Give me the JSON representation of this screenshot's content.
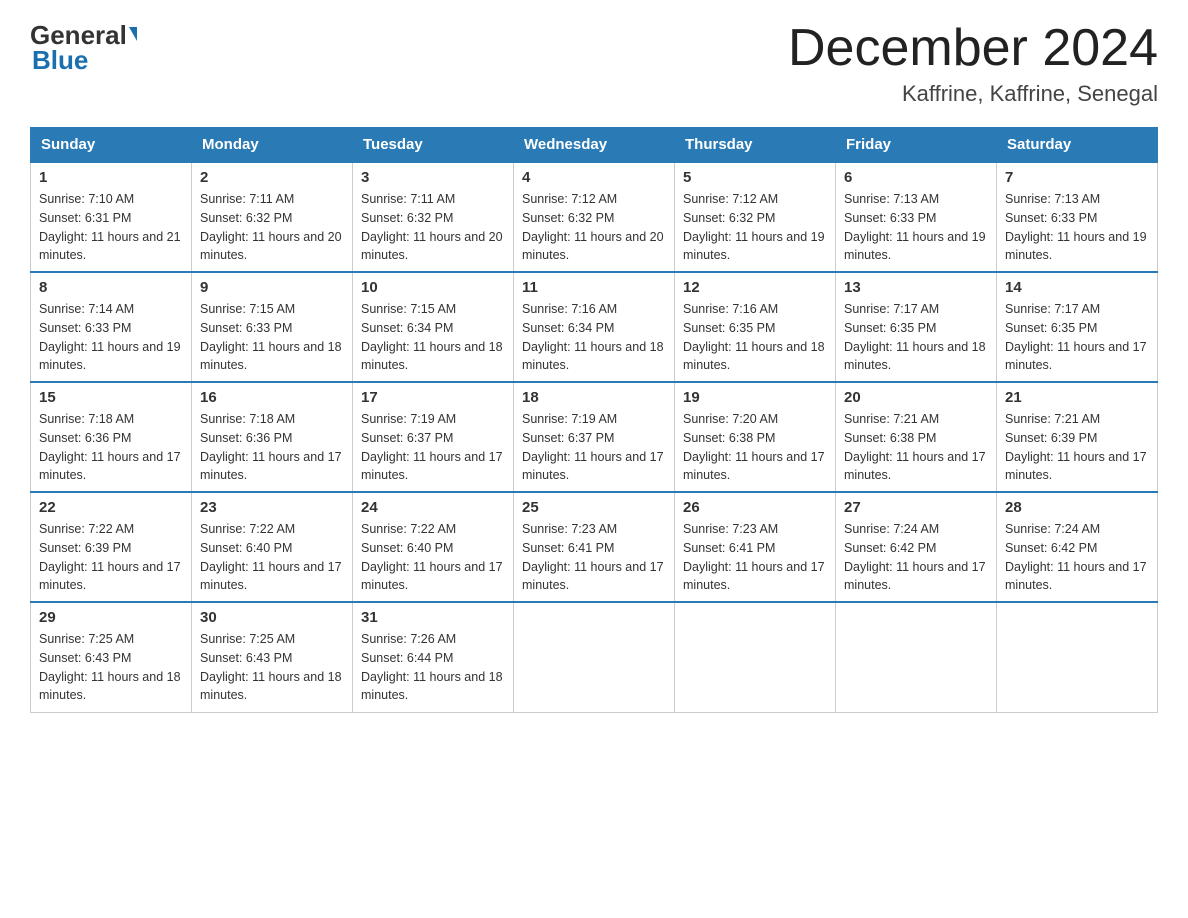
{
  "header": {
    "logo_general": "General",
    "logo_blue": "Blue",
    "month_title": "December 2024",
    "location": "Kaffrine, Kaffrine, Senegal"
  },
  "days_of_week": [
    "Sunday",
    "Monday",
    "Tuesday",
    "Wednesday",
    "Thursday",
    "Friday",
    "Saturday"
  ],
  "weeks": [
    [
      {
        "day": "1",
        "sunrise": "7:10 AM",
        "sunset": "6:31 PM",
        "daylight": "11 hours and 21 minutes."
      },
      {
        "day": "2",
        "sunrise": "7:11 AM",
        "sunset": "6:32 PM",
        "daylight": "11 hours and 20 minutes."
      },
      {
        "day": "3",
        "sunrise": "7:11 AM",
        "sunset": "6:32 PM",
        "daylight": "11 hours and 20 minutes."
      },
      {
        "day": "4",
        "sunrise": "7:12 AM",
        "sunset": "6:32 PM",
        "daylight": "11 hours and 20 minutes."
      },
      {
        "day": "5",
        "sunrise": "7:12 AM",
        "sunset": "6:32 PM",
        "daylight": "11 hours and 19 minutes."
      },
      {
        "day": "6",
        "sunrise": "7:13 AM",
        "sunset": "6:33 PM",
        "daylight": "11 hours and 19 minutes."
      },
      {
        "day": "7",
        "sunrise": "7:13 AM",
        "sunset": "6:33 PM",
        "daylight": "11 hours and 19 minutes."
      }
    ],
    [
      {
        "day": "8",
        "sunrise": "7:14 AM",
        "sunset": "6:33 PM",
        "daylight": "11 hours and 19 minutes."
      },
      {
        "day": "9",
        "sunrise": "7:15 AM",
        "sunset": "6:33 PM",
        "daylight": "11 hours and 18 minutes."
      },
      {
        "day": "10",
        "sunrise": "7:15 AM",
        "sunset": "6:34 PM",
        "daylight": "11 hours and 18 minutes."
      },
      {
        "day": "11",
        "sunrise": "7:16 AM",
        "sunset": "6:34 PM",
        "daylight": "11 hours and 18 minutes."
      },
      {
        "day": "12",
        "sunrise": "7:16 AM",
        "sunset": "6:35 PM",
        "daylight": "11 hours and 18 minutes."
      },
      {
        "day": "13",
        "sunrise": "7:17 AM",
        "sunset": "6:35 PM",
        "daylight": "11 hours and 18 minutes."
      },
      {
        "day": "14",
        "sunrise": "7:17 AM",
        "sunset": "6:35 PM",
        "daylight": "11 hours and 17 minutes."
      }
    ],
    [
      {
        "day": "15",
        "sunrise": "7:18 AM",
        "sunset": "6:36 PM",
        "daylight": "11 hours and 17 minutes."
      },
      {
        "day": "16",
        "sunrise": "7:18 AM",
        "sunset": "6:36 PM",
        "daylight": "11 hours and 17 minutes."
      },
      {
        "day": "17",
        "sunrise": "7:19 AM",
        "sunset": "6:37 PM",
        "daylight": "11 hours and 17 minutes."
      },
      {
        "day": "18",
        "sunrise": "7:19 AM",
        "sunset": "6:37 PM",
        "daylight": "11 hours and 17 minutes."
      },
      {
        "day": "19",
        "sunrise": "7:20 AM",
        "sunset": "6:38 PM",
        "daylight": "11 hours and 17 minutes."
      },
      {
        "day": "20",
        "sunrise": "7:21 AM",
        "sunset": "6:38 PM",
        "daylight": "11 hours and 17 minutes."
      },
      {
        "day": "21",
        "sunrise": "7:21 AM",
        "sunset": "6:39 PM",
        "daylight": "11 hours and 17 minutes."
      }
    ],
    [
      {
        "day": "22",
        "sunrise": "7:22 AM",
        "sunset": "6:39 PM",
        "daylight": "11 hours and 17 minutes."
      },
      {
        "day": "23",
        "sunrise": "7:22 AM",
        "sunset": "6:40 PM",
        "daylight": "11 hours and 17 minutes."
      },
      {
        "day": "24",
        "sunrise": "7:22 AM",
        "sunset": "6:40 PM",
        "daylight": "11 hours and 17 minutes."
      },
      {
        "day": "25",
        "sunrise": "7:23 AM",
        "sunset": "6:41 PM",
        "daylight": "11 hours and 17 minutes."
      },
      {
        "day": "26",
        "sunrise": "7:23 AM",
        "sunset": "6:41 PM",
        "daylight": "11 hours and 17 minutes."
      },
      {
        "day": "27",
        "sunrise": "7:24 AM",
        "sunset": "6:42 PM",
        "daylight": "11 hours and 17 minutes."
      },
      {
        "day": "28",
        "sunrise": "7:24 AM",
        "sunset": "6:42 PM",
        "daylight": "11 hours and 17 minutes."
      }
    ],
    [
      {
        "day": "29",
        "sunrise": "7:25 AM",
        "sunset": "6:43 PM",
        "daylight": "11 hours and 18 minutes."
      },
      {
        "day": "30",
        "sunrise": "7:25 AM",
        "sunset": "6:43 PM",
        "daylight": "11 hours and 18 minutes."
      },
      {
        "day": "31",
        "sunrise": "7:26 AM",
        "sunset": "6:44 PM",
        "daylight": "11 hours and 18 minutes."
      },
      null,
      null,
      null,
      null
    ]
  ]
}
